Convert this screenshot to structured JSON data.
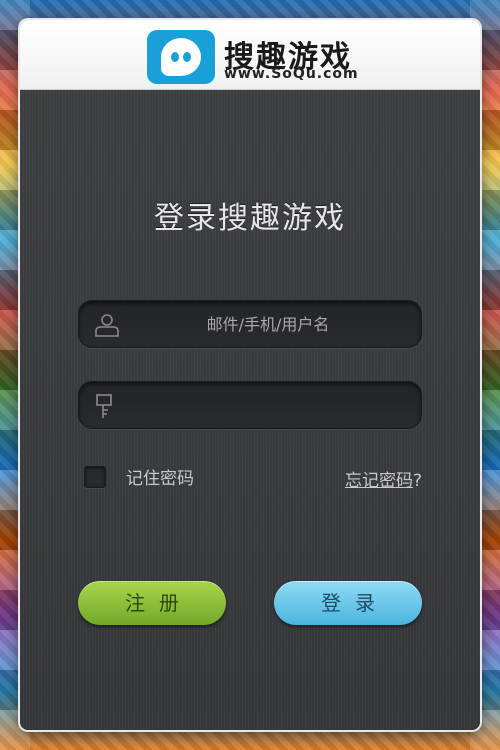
{
  "header": {
    "logo_title": "搜趣游戏",
    "logo_url": "www.SoQu.com"
  },
  "login": {
    "title": "登录搜趣游戏",
    "username_placeholder": "邮件/手机/用户名",
    "password_value": "",
    "remember_label": "记住密码",
    "forgot_label": "忘记密码",
    "forgot_suffix": "?",
    "register_button": "注册",
    "login_button": "登录"
  },
  "colors": {
    "register_button": "#8cc13a",
    "login_button": "#6cc7ea",
    "panel_bg": "#3a3c40"
  }
}
